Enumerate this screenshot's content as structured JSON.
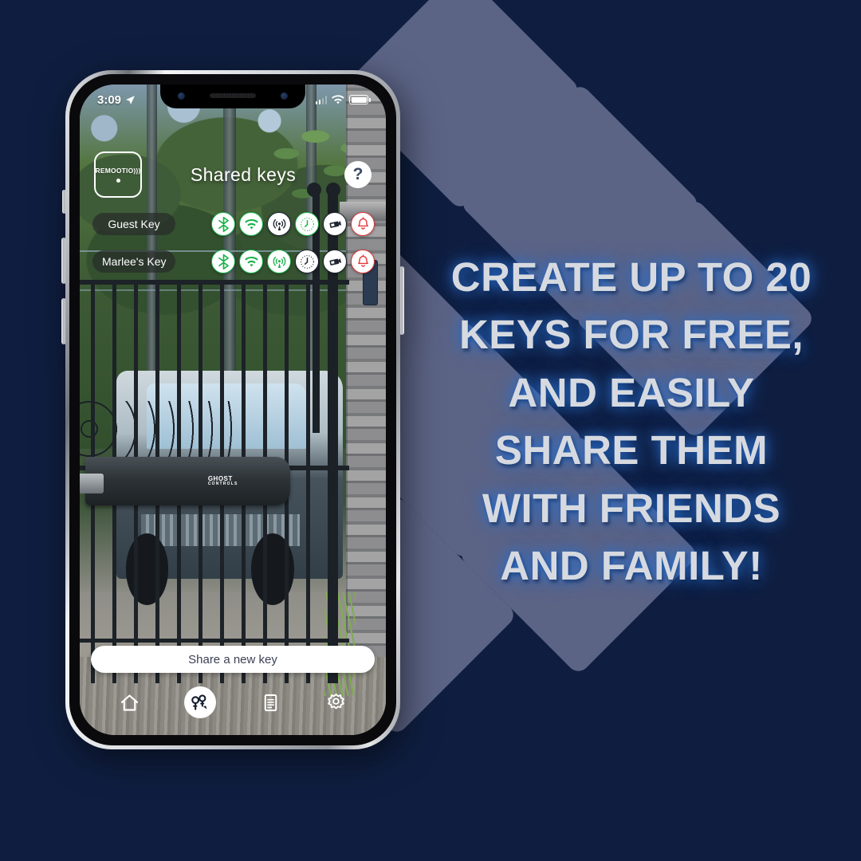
{
  "promo": {
    "headline_lines": [
      "CREATE UP TO 20",
      "KEYS FOR FREE,",
      "AND EASILY",
      "SHARE THEM",
      "WITH FRIENDS",
      "AND FAMILY!"
    ],
    "background_color": "#0f1e40",
    "accent_shape_color": "#5c6486",
    "headline_color": "#d6dae0",
    "headline_glow_color": "#296ecd"
  },
  "phone": {
    "status_bar": {
      "time": "3:09",
      "location_icon": "location-arrow-icon",
      "signal_icon": "cellular-bars-icon",
      "wifi_icon": "wifi-icon",
      "battery_icon": "battery-full-icon"
    },
    "app": {
      "logo_text": "REMOOTIO)))",
      "title": "Shared keys",
      "help_label": "?",
      "keys": [
        {
          "name": "Guest Key",
          "permissions": [
            {
              "icon": "bluetooth-icon",
              "state": "green"
            },
            {
              "icon": "wifi-icon",
              "state": "green"
            },
            {
              "icon": "cellular-antenna-icon",
              "state": "dark"
            },
            {
              "icon": "clock-icon",
              "state": "green"
            },
            {
              "icon": "camera-icon",
              "state": "dark"
            },
            {
              "icon": "bell-icon",
              "state": "red"
            }
          ]
        },
        {
          "name": "Marlee's Key",
          "permissions": [
            {
              "icon": "bluetooth-icon",
              "state": "green"
            },
            {
              "icon": "wifi-icon",
              "state": "green"
            },
            {
              "icon": "cellular-antenna-icon",
              "state": "green"
            },
            {
              "icon": "clock-icon",
              "state": "dark"
            },
            {
              "icon": "camera-icon",
              "state": "dark"
            },
            {
              "icon": "bell-icon",
              "state": "red"
            }
          ]
        }
      ],
      "share_button_label": "Share a new key",
      "bottom_nav": [
        {
          "icon": "home-icon",
          "active": false
        },
        {
          "icon": "share-key-icon",
          "active": true
        },
        {
          "icon": "log-document-icon",
          "active": false
        },
        {
          "icon": "settings-gear-icon",
          "active": false
        }
      ]
    },
    "wallpaper": {
      "scene": "driveway-gate-photo",
      "gate_opener_brand": "GHOST",
      "gate_opener_sub": "CONTROLS"
    }
  }
}
